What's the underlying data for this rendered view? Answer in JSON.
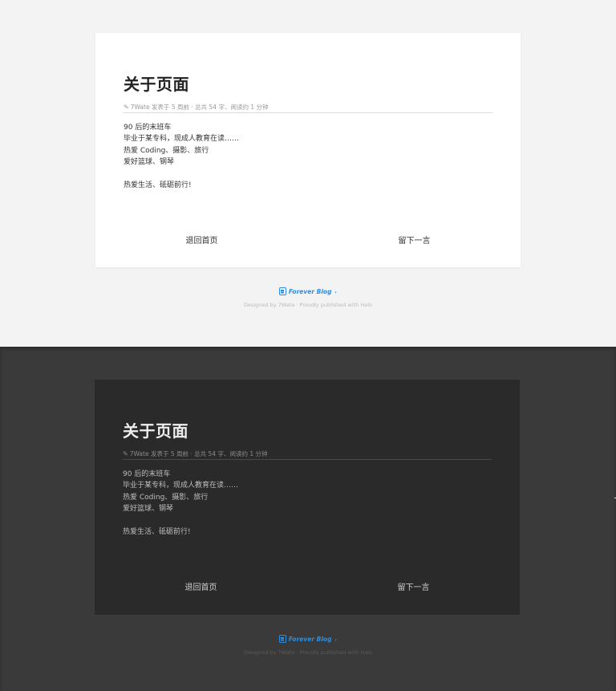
{
  "page": {
    "title": "关于页面",
    "meta": "7Wate 发表于 5 周前 · 总共 54 字、阅读约 1 分钟",
    "content_lines": [
      "90 后的末班车",
      "毕业于某专科，现成人教育在读……",
      "热爱 Coding、摄影、旅行",
      "爱好篮球、钢琴"
    ],
    "motto": "热爱生活、砥砺前行!",
    "actions": {
      "home": "退回首页",
      "comment": "留下一言"
    }
  },
  "footer": {
    "brand": "Forever Blog",
    "brand_suffix": ".",
    "designed": "Designed by 7Wate · Proudly published with Halo"
  },
  "colors": {
    "accent": "#2a8ee6",
    "light_bg": "#f3f3f3",
    "dark_bg": "#3a3a3a",
    "dark_card": "#2a2a2a"
  }
}
